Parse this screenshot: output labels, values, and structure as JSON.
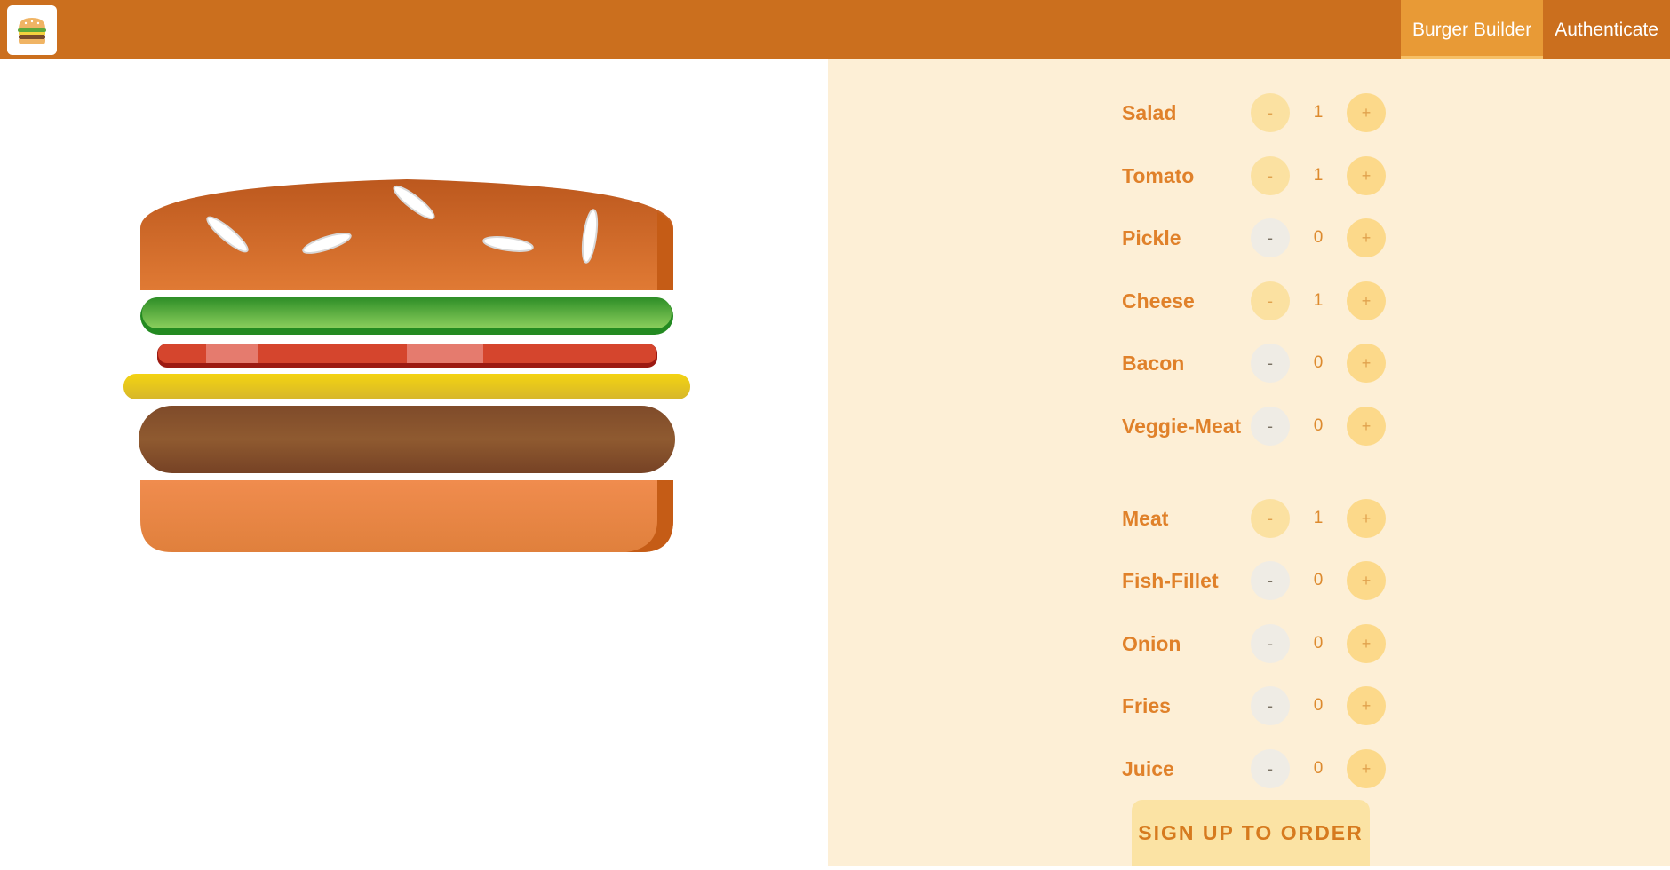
{
  "header": {
    "logo_icon": "burger-logo-icon",
    "nav": [
      {
        "label": "Burger Builder",
        "active": true
      },
      {
        "label": "Authenticate",
        "active": false
      }
    ]
  },
  "burger": {
    "layers": [
      "bread-top",
      "salad",
      "tomato",
      "cheese",
      "meat",
      "bread-bottom"
    ]
  },
  "controls": {
    "ingredients": [
      {
        "label": "Salad",
        "qty": "1"
      },
      {
        "label": "Tomato",
        "qty": "1"
      },
      {
        "label": "Pickle",
        "qty": "0"
      },
      {
        "label": "Cheese",
        "qty": "1"
      },
      {
        "label": "Bacon",
        "qty": "0"
      },
      {
        "label": "Veggie-Meat",
        "qty": "0"
      },
      {
        "label": "Meat",
        "qty": "1"
      },
      {
        "label": "Fish-Fillet",
        "qty": "0"
      },
      {
        "label": "Onion",
        "qty": "0"
      },
      {
        "label": "Fries",
        "qty": "0"
      },
      {
        "label": "Juice",
        "qty": "0"
      }
    ],
    "less_label": "-",
    "more_label": "+",
    "order_label": "SIGN UP TO ORDER"
  },
  "colors": {
    "toolbar": "#cb6f1e",
    "nav_active": "#e89a36",
    "controls_bg": "#fdefd6",
    "label": "#e0812a"
  }
}
